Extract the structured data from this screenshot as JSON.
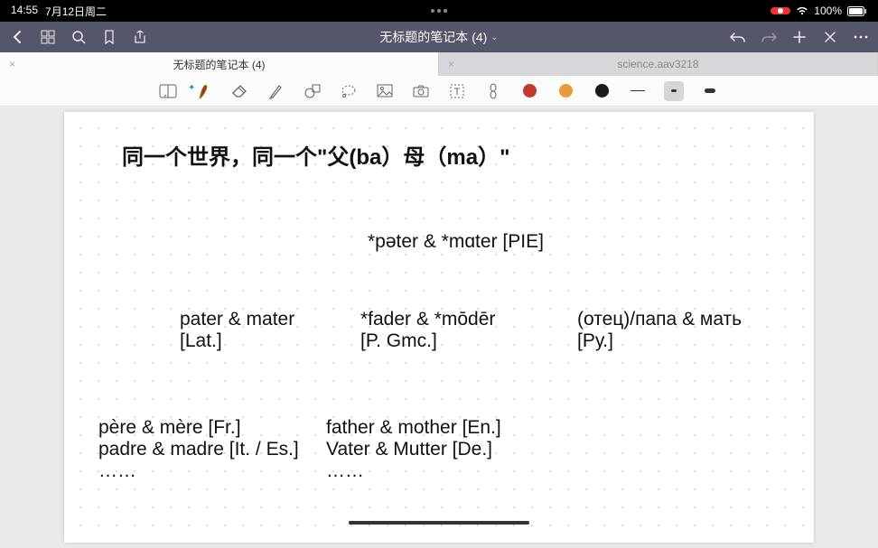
{
  "statusbar": {
    "time": "14:55",
    "date": "7月12日周二",
    "battery_pct": "100%"
  },
  "titlebar": {
    "title": "无标题的笔记本 (4)"
  },
  "tabs": [
    {
      "label": "无标题的笔记本 (4)",
      "active": true
    },
    {
      "label": "science.aav3218",
      "active": false
    }
  ],
  "toolbar": {
    "colors": {
      "red": "#c0392b",
      "orange": "#e79b3a",
      "black": "#1a1a1a"
    }
  },
  "note": {
    "title": "同一个世界，同一个\"父(ba）母（ma）\"",
    "pie": "*pəter & *mɑter [PIE]",
    "latin_l1": "pater & mater",
    "latin_l2": "[Lat.]",
    "pgmc_l1": "*fader & *mōdēr",
    "pgmc_l2": " [P. Gmc.]",
    "ru_l1": "(отец)/папа & мать",
    "ru_l2": "[Ру.]",
    "fr": "père & mère [Fr.]",
    "ites": "padre & madre [It. / Es.]",
    "dots1": "……",
    "en": "father & mother [En.]",
    "de": "Vater & Mutter [De.]",
    "dots2": "……"
  }
}
